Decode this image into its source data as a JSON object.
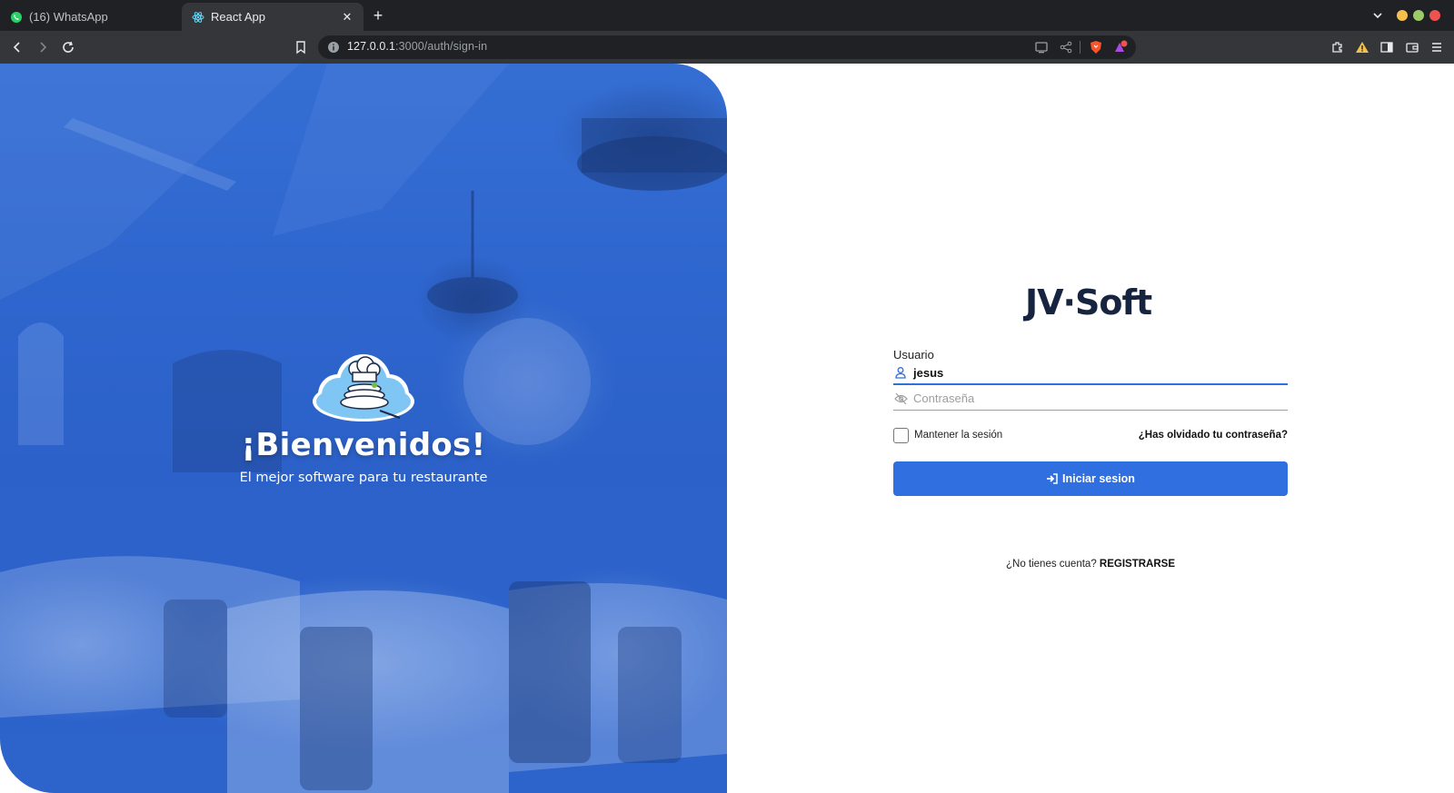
{
  "browser": {
    "tabs": [
      {
        "title": "(16) WhatsApp",
        "active": false,
        "icon": "whatsapp-icon"
      },
      {
        "title": "React App",
        "active": true,
        "icon": "react-icon"
      }
    ],
    "url": {
      "host": "127.0.0.1",
      "path": ":3000/auth/sign-in"
    },
    "window_colors": {
      "minimize": "#f4c04c",
      "maximize": "#9ccc65",
      "close": "#ef5350"
    }
  },
  "hero": {
    "title": "¡Bienvenidos!",
    "subtitle": "El mejor software para tu restaurante",
    "accent": "#2f66cf"
  },
  "brand": {
    "logo_text": "JV·Soft",
    "color": "#16243f"
  },
  "form": {
    "username_label": "Usuario",
    "username_value": "jesus",
    "password_placeholder": "Contraseña",
    "remember_label": "Mantener la sesión",
    "remember_checked": false,
    "forgot_label": "¿Has olvidado tu contraseña?",
    "submit_label": "Iniciar sesion",
    "accent": "#2f6fe0"
  },
  "signup": {
    "prompt": "¿No tienes cuenta?",
    "link": "REGISTRARSE"
  }
}
